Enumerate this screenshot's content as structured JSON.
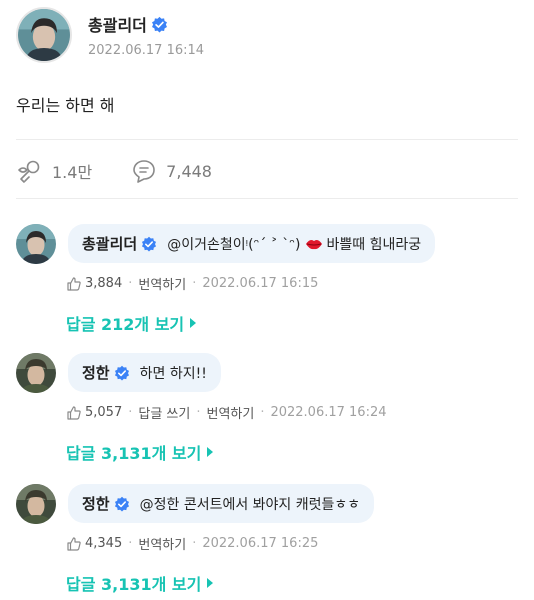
{
  "post": {
    "author": "총괄리더",
    "date": "2022.06.17 16:14",
    "body": "우리는 하면 해",
    "likes": "1.4만",
    "comments": "7,448"
  },
  "comments": [
    {
      "author": "총괄리더",
      "text_before": "@이거손철이ᵎ(ᵔ´ ˃ `ᵔ)",
      "text_after": "바쁠때 힘내라궁",
      "likes": "3,884",
      "actions": [
        "번역하기"
      ],
      "time": "2022.06.17 16:15",
      "replies": "답글 212개 보기"
    },
    {
      "author": "정한",
      "text_before": "하면 하지!!",
      "text_after": "",
      "likes": "5,057",
      "actions": [
        "답글 쓰기",
        "번역하기"
      ],
      "time": "2022.06.17 16:24",
      "replies": "답글 3,131개 보기"
    },
    {
      "author": "정한",
      "text_before": "@정한 콘서트에서 봐야지 캐럿들ㅎㅎ",
      "text_after": "",
      "likes": "4,345",
      "actions": [
        "번역하기"
      ],
      "time": "2022.06.17 16:25",
      "replies": "답글 3,131개 보기"
    }
  ],
  "colors": {
    "accent": "#17c3b3",
    "verified": "#3b82f6",
    "bubble": "#edf4fb"
  },
  "icons": {
    "verified": "verified-badge-icon",
    "like": "like-icon",
    "comment": "comment-icon",
    "emoji": "lips-emoji-icon"
  }
}
